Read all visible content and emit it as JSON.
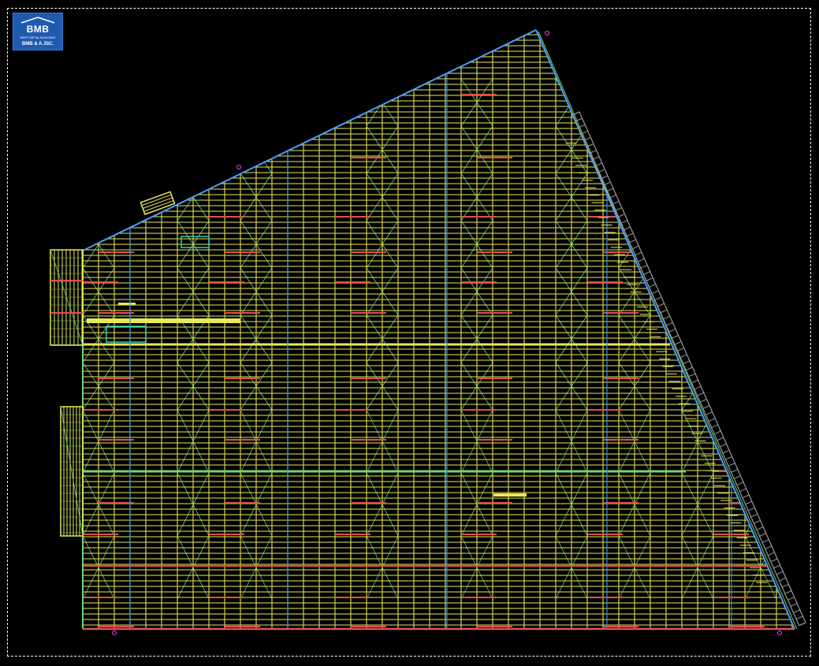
{
  "app": {
    "view": "roof framing plan"
  },
  "logo": {
    "brand": "BMB",
    "tagline": "BEST METAL BUILDING",
    "company": "BMB & A JSC."
  },
  "colors": {
    "background": "#000000",
    "purlin": "#e8e85a",
    "rafter": "#d9d24a",
    "beam": "#e05050",
    "bracing": "#6fd66f",
    "column_line": "#2f8fe0",
    "eave": "#4aa0ff",
    "marker": "#ff40ff",
    "gutter": "#9a9a9a",
    "frame_border": "#ffffff",
    "logo_bg": "#1e5bb0"
  },
  "icons": [
    "grid-marker-icon",
    "logo-roof-icon"
  ]
}
